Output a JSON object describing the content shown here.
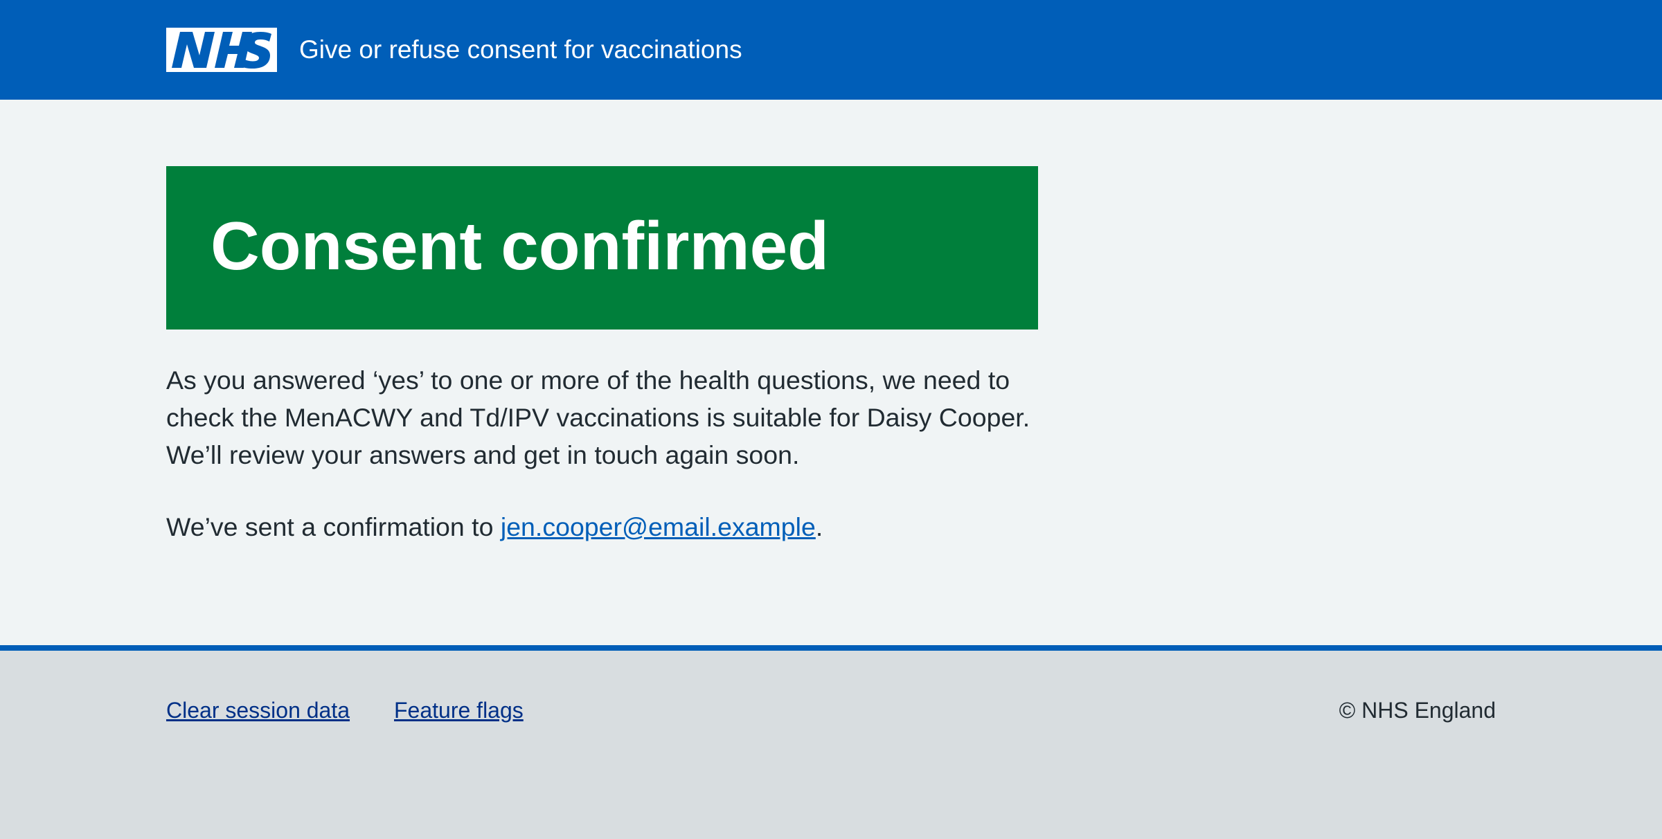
{
  "header": {
    "logo_text": "NHS",
    "service_name": "Give or refuse consent for vaccinations"
  },
  "main": {
    "panel_title": "Consent confirmed",
    "body_text": "As you answered ‘yes’ to one or more of the health questions, we need to check the MenACWY and Td/IPV vaccinations is suitable for Daisy Cooper. We’ll review your answers and get in touch again soon.",
    "confirmation_prefix": "We’ve sent a confirmation to ",
    "confirmation_email": "jen.cooper@email.example",
    "confirmation_suffix": "."
  },
  "footer": {
    "links": [
      "Clear session data",
      "Feature flags"
    ],
    "copyright": "© NHS England"
  },
  "colors": {
    "header_blue": "#005eb8",
    "success_green": "#007f3b",
    "page_background": "#f0f4f5",
    "footer_background": "#d8dde0",
    "link_blue": "#005eb8",
    "footer_link": "#003087",
    "text": "#212b32"
  }
}
